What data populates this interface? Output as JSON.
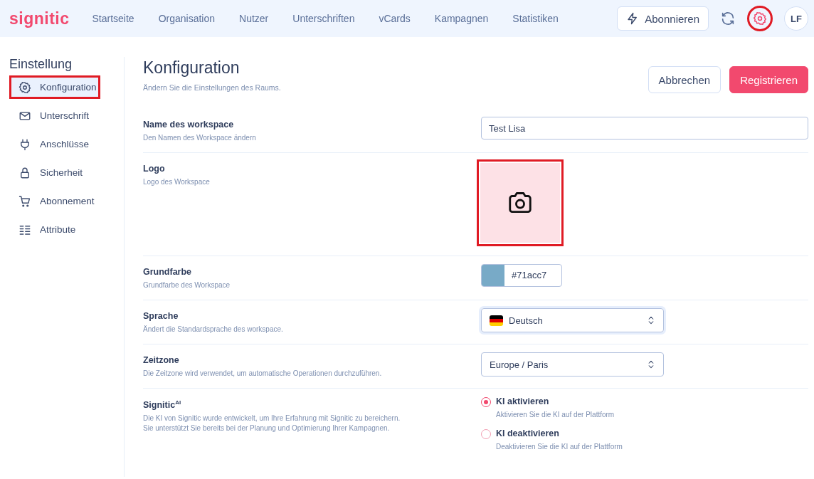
{
  "topbar": {
    "logo": "signitic",
    "nav": [
      "Startseite",
      "Organisation",
      "Nutzer",
      "Unterschriften",
      "vCards",
      "Kampagnen",
      "Statistiken"
    ],
    "subscribe_button": "Abonnieren",
    "settings_highlighted": true,
    "avatar": "LF"
  },
  "sidebar": {
    "title": "Einstellung",
    "items": [
      {
        "label": "Konfiguration",
        "selected": true,
        "highlighted": true
      },
      {
        "label": "Unterschrift",
        "selected": false,
        "highlighted": false
      },
      {
        "label": "Anschlüsse",
        "selected": false,
        "highlighted": false
      },
      {
        "label": "Sicherheit",
        "selected": false,
        "highlighted": false
      },
      {
        "label": "Abonnement",
        "selected": false,
        "highlighted": false
      },
      {
        "label": "Attribute",
        "selected": false,
        "highlighted": false
      }
    ]
  },
  "page": {
    "title": "Konfiguration",
    "subtitle": "Ändern Sie die Einstellungen des Raums.",
    "buttons": {
      "cancel": "Abbrechen",
      "save": "Registrieren"
    }
  },
  "settings": [
    {
      "kind": "text",
      "label": "Name des workspace",
      "description": "Den Namen des Workspace ändern",
      "value": "Test Lisa"
    },
    {
      "kind": "logo",
      "label": "Logo",
      "description": "Logo des Workspace",
      "highlighted": true
    },
    {
      "kind": "color",
      "label": "Grundfarbe",
      "description": "Grundfarbe des Workspace",
      "value": "#71acc7",
      "color": "#78aac7"
    },
    {
      "kind": "language_select",
      "label": "Sprache",
      "description": "Ändert die Standardsprache des workspace.",
      "value": "Deutsch",
      "focused": true
    },
    {
      "kind": "select",
      "label": "Zeitzone",
      "description": "Die Zeitzone wird verwendet, um automatische Operationen durchzuführen.",
      "value": "Europe / Paris",
      "focused": false
    },
    {
      "kind": "radio",
      "label": "Signitic$^{AI}$",
      "description": "Die KI von Signitic wurde entwickelt, um Ihre Erfahrung mit Signitic zu bereichern.\nSie unterstützt Sie bereits bei der Planung und Optimierung Ihrer Kampagnen.",
      "options": [
        {
          "label": "KI aktivieren",
          "hint": "Aktivieren Sie die KI auf der Plattform",
          "selected": true
        },
        {
          "label": "KI deaktivieren",
          "hint": "Deaktivieren Sie die KI auf der Plattform",
          "selected": false
        }
      ]
    }
  ]
}
